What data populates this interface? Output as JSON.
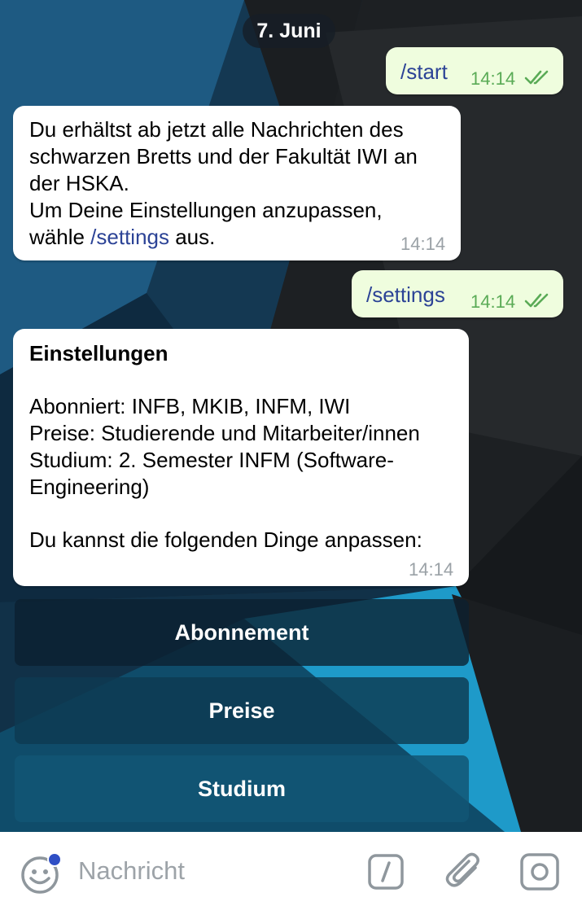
{
  "chat": {
    "date_label": "7. Juni",
    "messages": [
      {
        "direction": "outgoing",
        "text": "/start",
        "time": "14:14",
        "status": "read"
      },
      {
        "direction": "incoming",
        "lines": [
          "Du erhältst ab jetzt alle Nachrichten des",
          "schwarzen Bretts und der Fakultät IWI an",
          "der HSKA.",
          "Um Deine Einstellungen anzupassen,"
        ],
        "last_line_before": "wähle ",
        "last_line_link": "/settings",
        "last_line_after": " aus.",
        "time": "14:14"
      },
      {
        "direction": "outgoing",
        "text": "/settings",
        "time": "14:14",
        "status": "read"
      },
      {
        "direction": "incoming",
        "title": "Einstellungen",
        "lines": [
          "Abonniert: INFB, MKIB, INFM, IWI",
          "Preise: Studierende und Mitarbeiter/innen",
          "Studium: 2. Semester INFM (Software-",
          "Engineering)",
          "Du kannst die folgenden Dinge anpassen:"
        ],
        "time": "14:14"
      }
    ],
    "inline_keyboard": [
      "Abonnement",
      "Preise",
      "Studium"
    ]
  },
  "input_bar": {
    "placeholder": "Nachricht",
    "icons": [
      "emoji-icon",
      "bot-command-icon",
      "attach-icon",
      "camera-icon"
    ],
    "emoji_badge_color": "#2f4fc5"
  },
  "colors": {
    "outgoing_bubble": "#effdde",
    "incoming_bubble": "#ffffff",
    "outgoing_text": "#2c4396",
    "outgoing_meta": "#5aab56",
    "incoming_meta": "#9aa1a6",
    "link": "#2c4396"
  }
}
